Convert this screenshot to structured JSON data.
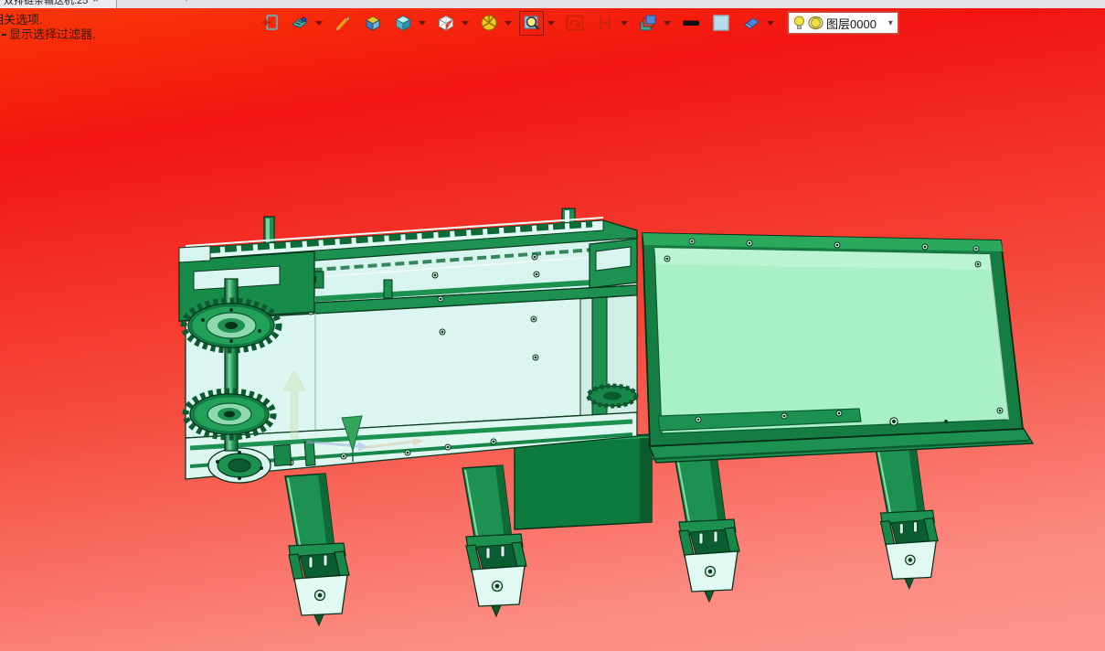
{
  "tab_bar": {
    "tab_title": "双排链条输送机.25",
    "close_label": "×",
    "new_tab_label": "+"
  },
  "viewport_overlay": {
    "line1": "相关选项.",
    "line2": "显示选择过滤器."
  },
  "toolbar": {
    "icons": [
      {
        "name": "exit-sketch-icon",
        "dropdown": false
      },
      {
        "name": "view-orientation-icon",
        "dropdown": true
      },
      {
        "name": "pen-icon",
        "dropdown": false
      },
      {
        "name": "open-box-icon",
        "dropdown": false
      },
      {
        "name": "shaded-view-icon",
        "dropdown": true
      },
      {
        "name": "wireframe-view-icon",
        "dropdown": true
      },
      {
        "name": "section-sphere-icon",
        "dropdown": true
      },
      {
        "name": "zoom-area-icon",
        "dropdown": true,
        "pressed": true
      },
      {
        "name": "motion-curve-icon",
        "dropdown": false
      },
      {
        "name": "section-grid-icon",
        "dropdown": true
      },
      {
        "name": "display-stack-icon",
        "dropdown": true
      },
      {
        "name": "line-weight-icon",
        "dropdown": false
      },
      {
        "name": "color-swatch-icon",
        "dropdown": false
      },
      {
        "name": "eraser-icon",
        "dropdown": true
      }
    ],
    "layer_selector": {
      "value": "图层0000",
      "dropdown_glyph": "▾"
    }
  },
  "colors": {
    "bg_top": "#f93606",
    "bg_red": "#f21511",
    "bg_bottom": "#fe958d",
    "machine_green": "#1c9150",
    "machine_dark_green": "#0d7a3e",
    "panel_cyan": "#dbf6f0",
    "table_mint": "#a9f0c7",
    "outline": "#06331b",
    "combo_border": "#c9473a",
    "tab_strip": "#e2e2e6"
  }
}
